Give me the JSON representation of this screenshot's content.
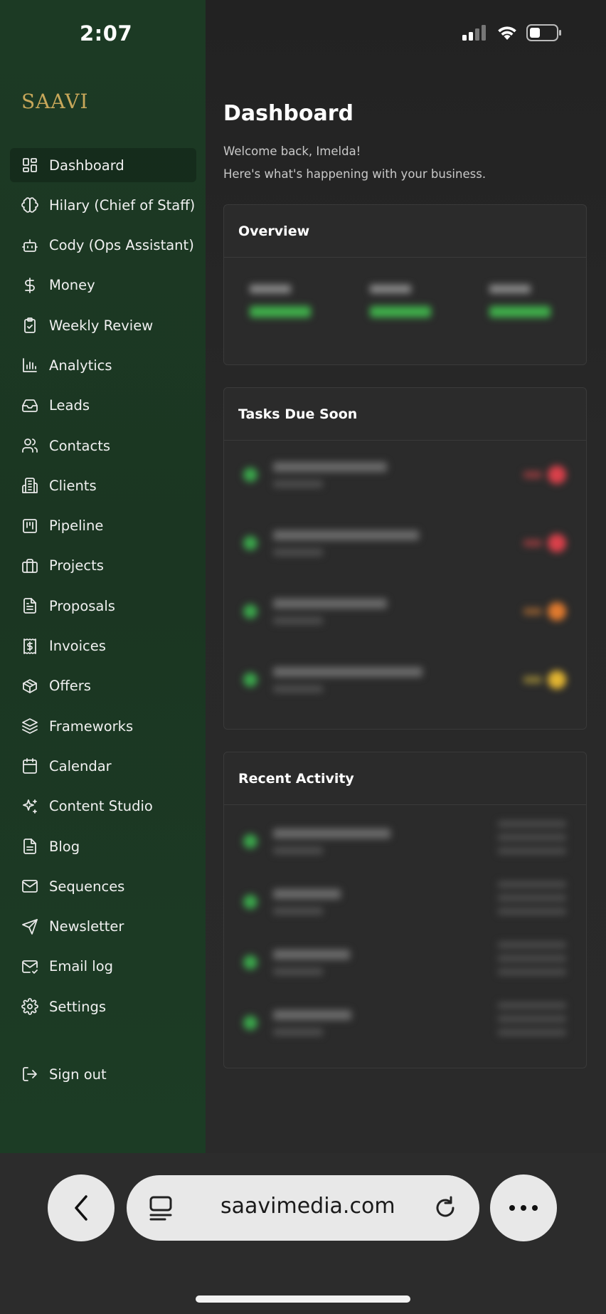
{
  "status_bar": {
    "time": "2:07"
  },
  "sidebar": {
    "logo": "SAAVI",
    "items": [
      {
        "label": "Dashboard",
        "icon": "grid-icon",
        "active": true
      },
      {
        "label": "Hilary (Chief of Staff)",
        "icon": "brain-icon"
      },
      {
        "label": "Cody (Ops Assistant)",
        "icon": "bot-icon"
      },
      {
        "label": "Money",
        "icon": "dollar-icon"
      },
      {
        "label": "Weekly Review",
        "icon": "clipboard-check-icon"
      },
      {
        "label": "Analytics",
        "icon": "bar-chart-icon"
      },
      {
        "label": "Leads",
        "icon": "inbox-icon"
      },
      {
        "label": "Contacts",
        "icon": "users-icon"
      },
      {
        "label": "Clients",
        "icon": "building-icon"
      },
      {
        "label": "Pipeline",
        "icon": "kanban-icon"
      },
      {
        "label": "Projects",
        "icon": "briefcase-icon"
      },
      {
        "label": "Proposals",
        "icon": "file-text-icon"
      },
      {
        "label": "Invoices",
        "icon": "receipt-icon"
      },
      {
        "label": "Offers",
        "icon": "package-icon"
      },
      {
        "label": "Frameworks",
        "icon": "layers-icon"
      },
      {
        "label": "Calendar",
        "icon": "calendar-icon"
      },
      {
        "label": "Content Studio",
        "icon": "sparkles-icon"
      },
      {
        "label": "Blog",
        "icon": "document-icon"
      },
      {
        "label": "Sequences",
        "icon": "mail-icon"
      },
      {
        "label": "Newsletter",
        "icon": "send-icon"
      },
      {
        "label": "Email log",
        "icon": "mail-check-icon"
      },
      {
        "label": "Settings",
        "icon": "gear-icon"
      }
    ],
    "signout": {
      "label": "Sign out",
      "icon": "logout-icon"
    }
  },
  "main": {
    "title": "Dashboard",
    "welcome_line1": "Welcome back, Imelda!",
    "welcome_line2": "Here's what's happening with your business.",
    "overview": {
      "title": "Overview"
    },
    "tasks": {
      "title": "Tasks Due Soon",
      "badge_colors": [
        "#d9404a",
        "#d9404a",
        "#e07a2e",
        "#e2b431"
      ]
    },
    "activity": {
      "title": "Recent Activity"
    }
  },
  "browser": {
    "url": "saavimedia.com"
  },
  "colors": {
    "sidebar_bg": "#1c3a24",
    "logo": "#c7a75a",
    "status_green": "#3aa64b"
  }
}
